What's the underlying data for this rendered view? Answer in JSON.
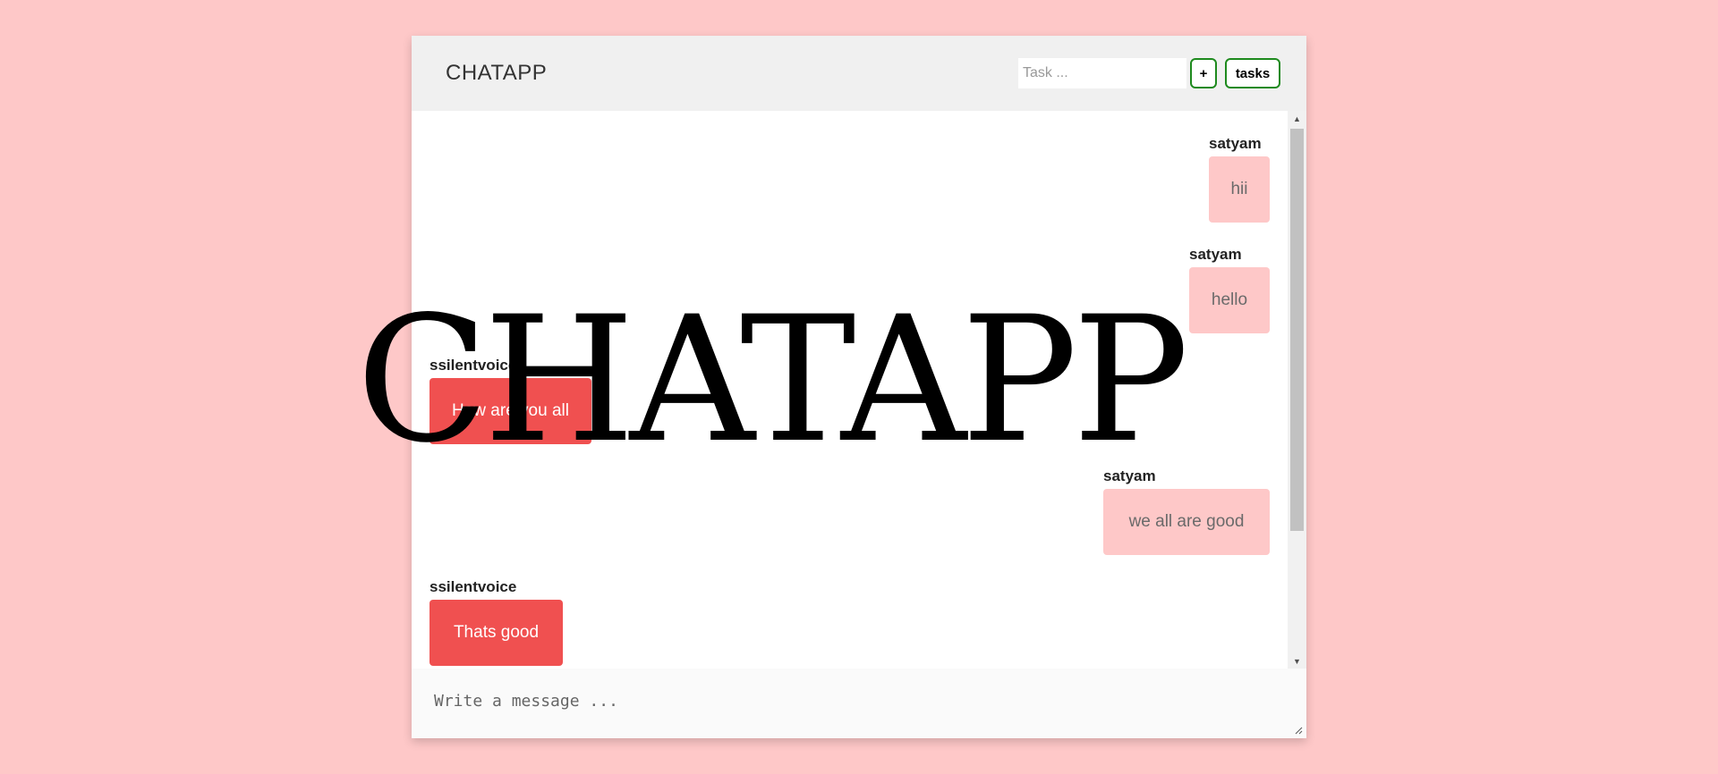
{
  "header": {
    "title": "CHATAPP",
    "task_placeholder": "Task ...",
    "add_label": "+",
    "tasks_label": "tasks"
  },
  "messages": [
    {
      "user": "satyam",
      "text": "hii",
      "side": "right"
    },
    {
      "user": "satyam",
      "text": "hello",
      "side": "right"
    },
    {
      "user": "ssilentvoice",
      "text": "How are you all",
      "side": "left"
    },
    {
      "user": "satyam",
      "text": "we all are good",
      "side": "right"
    },
    {
      "user": "ssilentvoice",
      "text": "Thats good",
      "side": "left"
    }
  ],
  "composer": {
    "placeholder": "Write a message ..."
  },
  "overlay": {
    "text": "CHATAPP"
  },
  "colors": {
    "page_background": "#fec8c8",
    "header_background": "#f0f0f0",
    "own_bubble": "#fec8c8",
    "other_bubble": "#f05050",
    "button_border": "#1e8a1e"
  }
}
